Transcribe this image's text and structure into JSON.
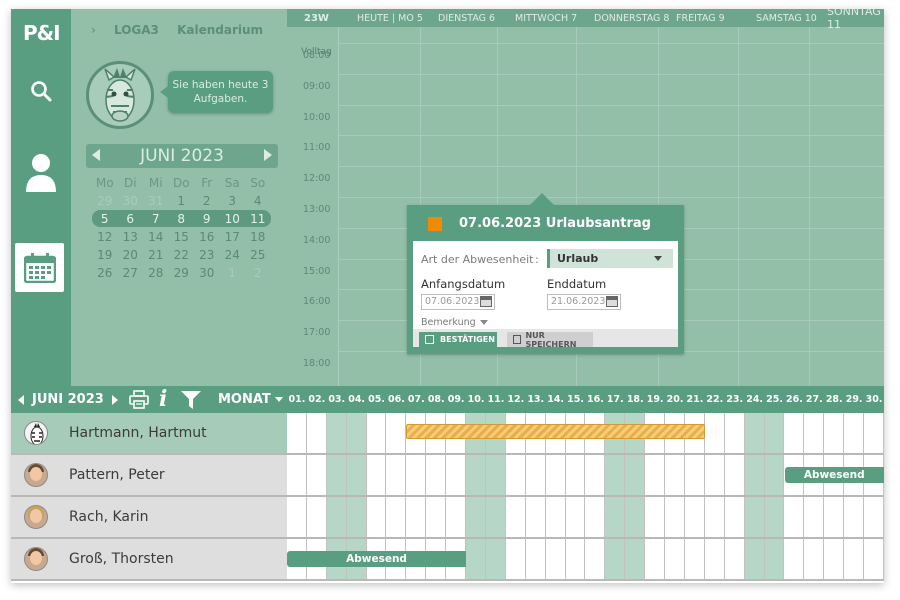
{
  "app": {
    "logo": "P&I"
  },
  "breadcrumb": {
    "items": [
      "LOGA3",
      "Kalendarium"
    ]
  },
  "greeting": "Sie haben heute 3 Aufgaben.",
  "mini_calendar": {
    "month": "JUNI 2023",
    "weekdays": [
      "Mo",
      "Di",
      "Mi",
      "Do",
      "Fr",
      "Sa",
      "So"
    ],
    "weeks": [
      [
        "29",
        "30",
        "31",
        "1",
        "2",
        "3",
        "4"
      ],
      [
        "5",
        "6",
        "7",
        "8",
        "9",
        "10",
        "11"
      ],
      [
        "12",
        "13",
        "14",
        "15",
        "16",
        "17",
        "18"
      ],
      [
        "19",
        "20",
        "21",
        "22",
        "23",
        "24",
        "25"
      ],
      [
        "26",
        "27",
        "28",
        "29",
        "30",
        "1",
        "2"
      ]
    ],
    "muted_first_week_count": 3,
    "muted_last_week_from": 5,
    "highlight_week": 1
  },
  "week_view": {
    "week": "23W",
    "days": [
      "HEUTE | MO 5",
      "DIENSTAG 6",
      "MITTWOCH 7",
      "DONNERSTAG 8",
      "FREITAG 9",
      "SAMSTAG 10",
      "SONNTAG 11"
    ],
    "allday_label": "Volltag",
    "hours": [
      "08:00",
      "09:00",
      "10:00",
      "11:00",
      "12:00",
      "13:00",
      "14:00",
      "15:00",
      "16:00",
      "17:00",
      "18:00"
    ]
  },
  "popup": {
    "title": "07.06.2023 Urlaubsantrag",
    "type_label": "Art der Abwesenheit",
    "type_colon": ":",
    "type_value": "Urlaub",
    "start_label": "Anfangsdatum",
    "start_value": "07.06.2023",
    "end_label": "Enddatum",
    "end_value": "21.06.2023",
    "remark_label": "Bemerkung",
    "confirm_label": "BESTÄTIGEN",
    "save_label": "NUR SPEICHERN",
    "accent": "#f08a00"
  },
  "month_bar": {
    "month": "JUNI 2023",
    "info_label": "i",
    "view_label": "MONAT",
    "days": [
      "01.",
      "02.",
      "03.",
      "04.",
      "05.",
      "06.",
      "07.",
      "08.",
      "09.",
      "10.",
      "11.",
      "12.",
      "13.",
      "14.",
      "15.",
      "16.",
      "17.",
      "18.",
      "19.",
      "20.",
      "21.",
      "22.",
      "23.",
      "24.",
      "25.",
      "26.",
      "27.",
      "28.",
      "29.",
      "30."
    ],
    "weekend_days": [
      3,
      4,
      10,
      11,
      17,
      18,
      24,
      25
    ]
  },
  "employees": [
    {
      "name": "Hartmann, Hartmut",
      "avatar": "zebra-avatar",
      "selected": true,
      "entries": [
        {
          "kind": "request",
          "from": 7,
          "to": 21,
          "label": ""
        }
      ]
    },
    {
      "name": "Pattern, Peter",
      "avatar": "man-avatar",
      "selected": false,
      "entries": [
        {
          "kind": "absent",
          "from": 26,
          "to": 30,
          "label": "Abwesend"
        }
      ]
    },
    {
      "name": "Rach, Karin",
      "avatar": "woman-avatar",
      "selected": false,
      "entries": []
    },
    {
      "name": "Groß, Thorsten",
      "avatar": "man-glasses-avatar",
      "selected": false,
      "entries": [
        {
          "kind": "absent",
          "from": 1,
          "to": 9,
          "label": "Abwesend"
        }
      ]
    }
  ],
  "colors": {
    "primary": "#5a9e82",
    "dim": "#93bfa9",
    "weekend": "#b6d6c7",
    "request": "#f5cc78"
  }
}
